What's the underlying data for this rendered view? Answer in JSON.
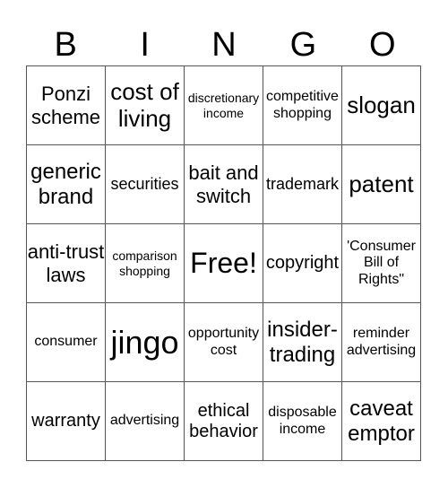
{
  "header": [
    "B",
    "I",
    "N",
    "G",
    "O"
  ],
  "grid": [
    [
      "Ponzi scheme",
      "cost of living",
      "discretionary income",
      "competitive shopping",
      "slogan"
    ],
    [
      "generic brand",
      "securities",
      "bait and switch",
      "trademark",
      "patent"
    ],
    [
      "anti-trust laws",
      "comparison shopping",
      "Free!",
      "copyright",
      "'Consumer Bill of Rights\""
    ],
    [
      "consumer",
      "jingo",
      "opportunity cost",
      "insider-trading",
      "reminder advertising"
    ],
    [
      "warranty",
      "advertising",
      "ethical behavior",
      "disposable income",
      "caveat emptor"
    ]
  ]
}
